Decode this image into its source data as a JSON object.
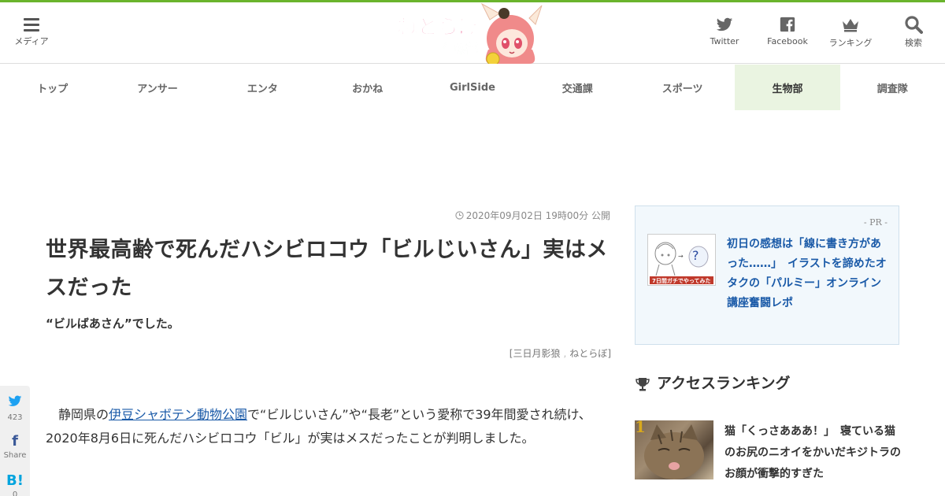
{
  "header": {
    "menu_label": "メディア",
    "logo_alt": "ねとらぼ 生物部",
    "buttons": [
      {
        "label": "Twitter",
        "icon": "twitter-icon"
      },
      {
        "label": "Facebook",
        "icon": "facebook-icon"
      },
      {
        "label": "ランキング",
        "icon": "crown-icon"
      },
      {
        "label": "検索",
        "icon": "search-icon"
      }
    ]
  },
  "nav": {
    "items": [
      "トップ",
      "アンサー",
      "エンタ",
      "おかね",
      "GirlSide",
      "交通課",
      "スポーツ",
      "生物部",
      "調査隊"
    ],
    "active": "生物部"
  },
  "article": {
    "date": "2020年09月02日 19時00分 公開",
    "title": "世界最高齢で死んだハシビロコウ「ビルじいさん」実はメスだった",
    "subtitle": "“ビルばあさん”でした。",
    "author": "三日月影狼",
    "publisher": "ねとらぼ",
    "body_pre": "静岡県の",
    "body_link": "伊豆シャボテン動物公園",
    "body_post": "で“ビルじいさん”や“長老”という愛称で39年間愛され続け、2020年8月6日に死んだハシビロコウ「ビル」が実はメスだったことが判明しました。"
  },
  "share": {
    "twitter_count": "423",
    "facebook_label": "Share",
    "hatena_count": "0"
  },
  "sidebar": {
    "pr_tag": "- PR -",
    "pr_text": "初日の感想は「線に書き方があった……」　イラストを諦めたオタクの「パルミー」オンライン講座奮闘レポ",
    "pr_thumb_caption": "7日間ガチでやってみた",
    "ranking_title": "アクセスランキング",
    "ranking": [
      {
        "rank": "1",
        "text": "猫「くっさあああ！」　寝ている猫のお尻のニオイをかいだキジトラのお顔が衝撃的すぎた"
      }
    ]
  },
  "colors": {
    "brand_green": "#6ab42d",
    "active_nav_bg": "#eaf4e1",
    "link_blue": "#1a5aa8",
    "rank_gold": "#d9a91c"
  }
}
